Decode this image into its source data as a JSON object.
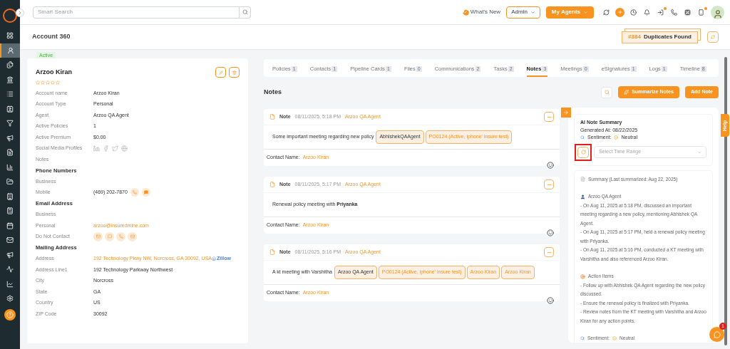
{
  "sidebar": {
    "items": [
      {
        "selected": false
      },
      {
        "selected": true
      },
      {
        "selected": false
      },
      {
        "selected": false
      },
      {
        "selected": false
      },
      {
        "selected": false
      },
      {
        "selected": false
      },
      {
        "selected": false
      },
      {
        "selected": false
      },
      {
        "selected": false
      },
      {
        "selected": false
      },
      {
        "selected": false
      },
      {
        "selected": false
      },
      {
        "selected": false
      },
      {
        "selected": false
      },
      {
        "selected": false
      },
      {
        "selected": false
      },
      {
        "selected": false
      },
      {
        "selected": false
      }
    ]
  },
  "header": {
    "search_placeholder": "Smart Search",
    "whats_new": "What's New",
    "role": "Admin",
    "agents_button": "My Agents",
    "icons": [
      {
        "dot": false
      },
      {
        "dot": false
      },
      {
        "dot": false
      },
      {
        "dot": false
      },
      {
        "dot": true
      },
      {
        "dot": false
      },
      {
        "dot": false
      },
      {
        "dot": true
      }
    ]
  },
  "page": {
    "title": "Account 360",
    "duplicates_count": "#384",
    "duplicates_label": "Duplicates Found"
  },
  "account": {
    "status": "Active",
    "name": "Arzoo Kiran",
    "stars": 0,
    "sections": [
      {
        "rows": [
          {
            "kind": "text",
            "label": "Account name",
            "value": "Arzoo Kiran"
          },
          {
            "kind": "text",
            "label": "Account Type",
            "value": "Personal"
          },
          {
            "kind": "text",
            "label": "Agent",
            "value": "Arzoo QA Agent"
          },
          {
            "kind": "text",
            "label": "Active Policies",
            "value": "1"
          },
          {
            "kind": "text",
            "label": "Active Premium",
            "value": "$0.00"
          },
          {
            "kind": "social",
            "label": "Social Media Profiles"
          },
          {
            "kind": "text",
            "label": "Notes"
          }
        ]
      },
      {
        "heading": "Phone Numbers",
        "rows": [
          {
            "kind": "text",
            "label": "Business"
          },
          {
            "kind": "phone",
            "label": "Mobile",
            "value": "(469) 202-7870"
          }
        ]
      },
      {
        "heading": "Email Address",
        "rows": [
          {
            "kind": "text",
            "label": "Business"
          },
          {
            "kind": "link",
            "label": "Personal",
            "value": "arzoo@insuredmine.com"
          },
          {
            "kind": "contact",
            "label": "Do Not Contact"
          }
        ]
      },
      {
        "heading": "Mailing Address",
        "rows": [
          {
            "kind": "address",
            "label": "Address",
            "value": "192 Technology Pkwy NW, Norcross, GA 30092, USA",
            "extra": "Zillow"
          },
          {
            "kind": "text",
            "label": "Address Line1",
            "value": "192 Technology Parkway Northwest"
          },
          {
            "kind": "text",
            "label": "City",
            "value": "Norcross"
          },
          {
            "kind": "text",
            "label": "State",
            "value": "GA"
          },
          {
            "kind": "text",
            "label": "Country",
            "value": "US"
          },
          {
            "kind": "text",
            "label": "ZIP Code",
            "value": "30092"
          }
        ]
      }
    ]
  },
  "tabs": [
    {
      "label": "Policies",
      "count": "1",
      "selected": false
    },
    {
      "label": "Contacts",
      "count": "1",
      "selected": false
    },
    {
      "label": "Pipeline Cards",
      "count": "1",
      "selected": false
    },
    {
      "label": "Files",
      "count": "0",
      "selected": false
    },
    {
      "label": "Communications",
      "count": "2",
      "selected": false
    },
    {
      "label": "Tasks",
      "count": "2",
      "selected": false
    },
    {
      "label": "Notes",
      "count": "3",
      "selected": true
    },
    {
      "label": "Meetings",
      "count": "0",
      "selected": false
    },
    {
      "label": "eSignatures",
      "count": "1",
      "selected": false
    },
    {
      "label": "Logs",
      "count": "1",
      "selected": false
    },
    {
      "label": "Timeline",
      "count": "8",
      "selected": false
    }
  ],
  "notes_panel": {
    "title": "Notes",
    "summarize_button": "Summarize Notes",
    "add_button": "Add Note",
    "notes": [
      {
        "title": "Note",
        "timestamp": "08/11/2025, 5:18 PM",
        "agent": "Arzoo QA Agent",
        "text": "Some important meeting regarding new policy",
        "mentions": [
          {
            "kind": "agent",
            "label": "AbhishekQAAgent"
          },
          {
            "kind": "record",
            "label": "PO0124 (Active,  iphone' insure test)"
          }
        ],
        "contact_label": "Contact Name:",
        "contact_name": "Arzoo Kiran"
      },
      {
        "title": "Note",
        "timestamp": "08/11/2025, 5:17 PM",
        "agent": "Arzoo QA Agent",
        "text": "Renewal policy meeting with **Priyanka**",
        "contact_label": "Contact Name:",
        "contact_name": "Arzoo Kiran"
      },
      {
        "title": "Note",
        "timestamp": "08/11/2025, 5:16 PM",
        "agent": "Arzoo QA Agent",
        "text": "A kt meeting with Varshitha",
        "mentions": [
          {
            "kind": "agent",
            "label": "Arzoo QA Agent"
          },
          {
            "kind": "record",
            "label": "PO0124 (Active,  iphone' insure test)"
          },
          {
            "kind": "record",
            "label": "Arzoo Kiran"
          },
          {
            "kind": "record",
            "label": "Arzoo Kiran"
          }
        ],
        "contact_label": "Contact Name:",
        "contact_name": "Arzoo Kiran"
      }
    ]
  },
  "ai_summary": {
    "title": "AI Note Summary",
    "generated": "Generated At: 08/22/2025",
    "sentiment_label": "Sentiment:",
    "sentiment_value": "Neutral",
    "time_range_placeholder": "Select Time Range",
    "summary_heading": "Summary (Last summarized: Aug 22, 2025)",
    "sections": [
      {
        "kind": "agent",
        "heading": "Arzoo QA Agent",
        "lines": [
          "- On Aug 11, 2025 at 5:18 PM, discussed an important meeting regarding a new policy, mentioning Abhishek QA Agent.",
          "- On Aug 11, 2025 at 5:17 PM, held a renewal policy meeting with Priyanka.",
          "- On Aug 11, 2025 at 5:16 PM, conducted a KT meeting with Varshitha and also referenced Arzoo Kiran."
        ]
      },
      {
        "kind": "actions",
        "heading": "Action Items",
        "lines": [
          "- Follow up with Abhishek QA Agent regarding the new policy discussed.",
          "- Ensure the renewal policy is finalized with Priyanka.",
          "- Review notes from the KT meeting with Varshitha and Arzoo Kiran for any action points."
        ]
      }
    ],
    "footer_sentiment_label": "Sentiment:",
    "footer_sentiment_value": "Neutral"
  },
  "help_tab": "Help",
  "chat_badge": "1"
}
